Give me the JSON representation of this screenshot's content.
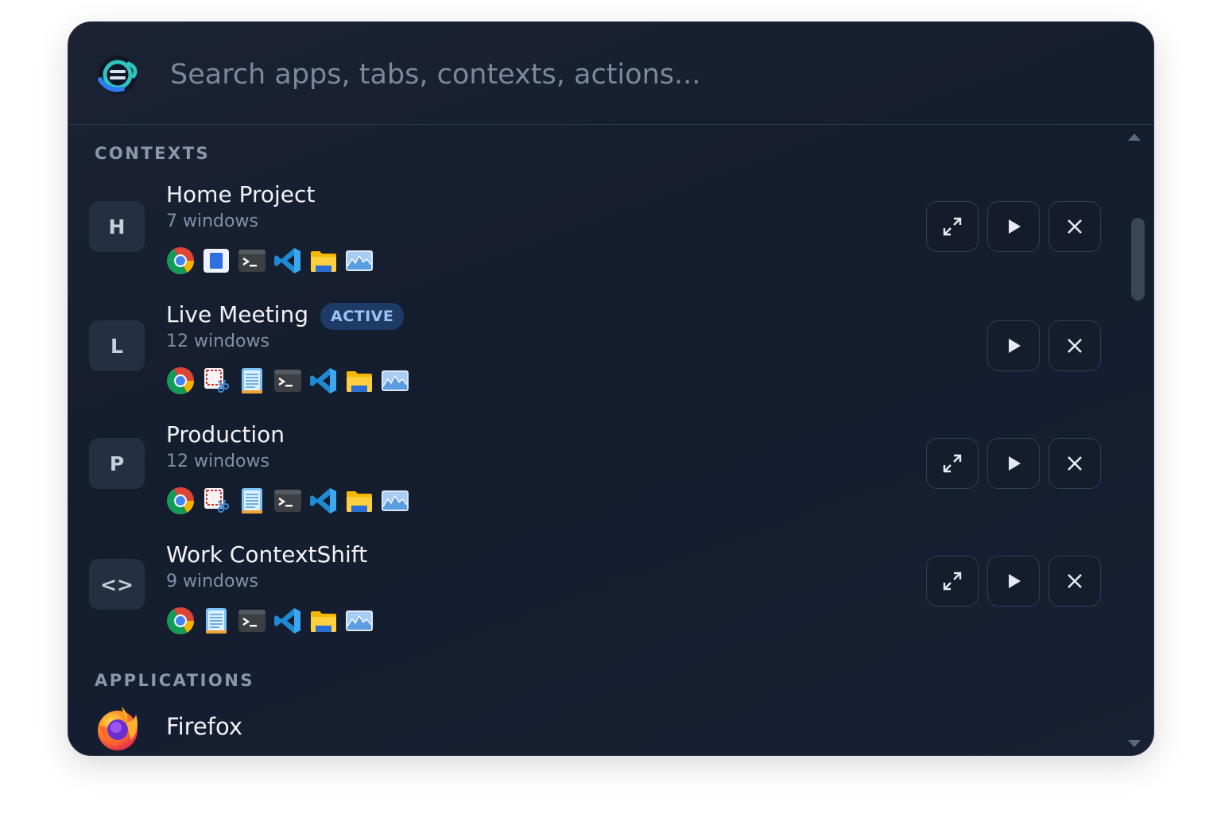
{
  "search": {
    "placeholder": "Search apps, tabs, contexts, actions..."
  },
  "sections": {
    "contexts": "CONTEXTS",
    "applications": "APPLICATIONS"
  },
  "contexts": [
    {
      "initial": "H",
      "title": "Home Project",
      "subtitle": "7 windows",
      "active_label": "",
      "apps": [
        "chrome-icon",
        "document-icon",
        "terminal-icon",
        "vscode-icon",
        "folder-icon",
        "image-viewer-icon"
      ],
      "actions": [
        "expand",
        "resume",
        "close"
      ]
    },
    {
      "initial": "L",
      "title": "Live Meeting",
      "subtitle": "12 windows",
      "active_label": "ACTIVE",
      "apps": [
        "chrome-icon",
        "screenshot-tool-icon",
        "notepad-icon",
        "terminal-icon",
        "vscode-icon",
        "folder-icon",
        "image-viewer-icon"
      ],
      "actions": [
        "resume",
        "close"
      ]
    },
    {
      "initial": "P",
      "title": "Production",
      "subtitle": "12 windows",
      "active_label": "",
      "apps": [
        "chrome-icon",
        "screenshot-tool-icon",
        "notepad-icon",
        "terminal-icon",
        "vscode-icon",
        "folder-icon",
        "image-viewer-icon"
      ],
      "actions": [
        "expand",
        "resume",
        "close"
      ]
    },
    {
      "initial": "<>",
      "title": "Work ContextShift",
      "subtitle": "9 windows",
      "active_label": "",
      "apps": [
        "chrome-icon",
        "notepad-icon",
        "terminal-icon",
        "vscode-icon",
        "folder-icon",
        "image-viewer-icon"
      ],
      "actions": [
        "expand",
        "resume",
        "close"
      ]
    }
  ],
  "applications": [
    {
      "name": "Firefox",
      "icon": "firefox-icon"
    }
  ],
  "colors": {
    "panel": "#161f30",
    "accent": "#9cc3f5",
    "active_bg": "#1e3a66"
  }
}
